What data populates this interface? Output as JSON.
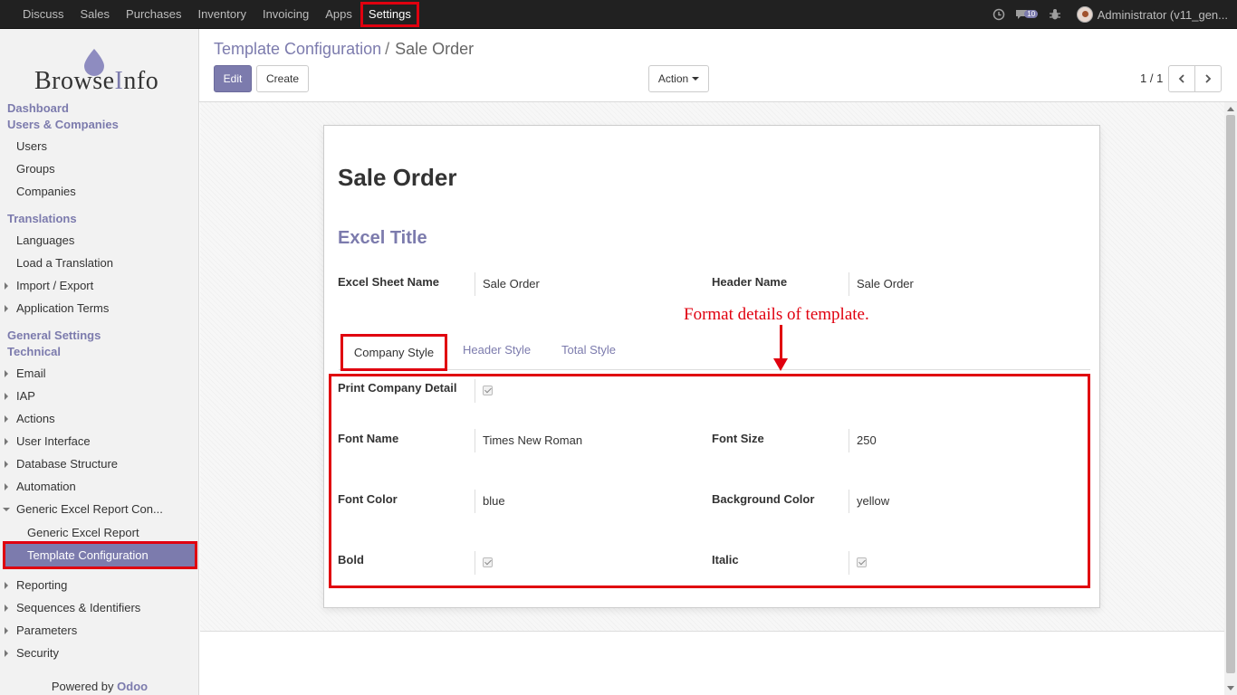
{
  "topbar": {
    "menu": [
      "Discuss",
      "Sales",
      "Purchases",
      "Inventory",
      "Invoicing",
      "Apps",
      "Settings"
    ],
    "active": "Settings",
    "messages_count": "10",
    "user": "Administrator (v11_gen..."
  },
  "logo": {
    "text_before": "Browse",
    "text_accent": "I",
    "text_after": "nfo"
  },
  "sidebar": {
    "dashboard": "Dashboard",
    "users_companies": "Users & Companies",
    "users": "Users",
    "groups": "Groups",
    "companies": "Companies",
    "translations": "Translations",
    "languages": "Languages",
    "load_translation": "Load a Translation",
    "import_export": "Import / Export",
    "application_terms": "Application Terms",
    "general_settings": "General Settings",
    "technical": "Technical",
    "email": "Email",
    "iap": "IAP",
    "actions": "Actions",
    "user_interface": "User Interface",
    "database_structure": "Database Structure",
    "automation": "Automation",
    "generic_excel_config": "Generic Excel Report Con...",
    "generic_excel_report": "Generic Excel Report",
    "template_configuration": "Template Configuration",
    "reporting": "Reporting",
    "sequences": "Sequences & Identifiers",
    "parameters": "Parameters",
    "security": "Security",
    "powered_by": "Powered by ",
    "odoo": "Odoo"
  },
  "breadcrumb": {
    "parent": "Template Configuration",
    "separator": "/",
    "current": "Sale Order"
  },
  "buttons": {
    "edit": "Edit",
    "create": "Create",
    "action": "Action"
  },
  "pager": "1 / 1",
  "record": {
    "title": "Sale Order",
    "section": "Excel Title",
    "excel_sheet_name_label": "Excel Sheet Name",
    "excel_sheet_name": "Sale Order",
    "header_name_label": "Header Name",
    "header_name": "Sale Order"
  },
  "tabs": [
    "Company Style",
    "Header Style",
    "Total Style"
  ],
  "company_style": {
    "print_company_detail_label": "Print Company Detail",
    "print_company_detail": true,
    "font_name_label": "Font Name",
    "font_name": "Times New Roman",
    "font_size_label": "Font Size",
    "font_size": "250",
    "font_color_label": "Font Color",
    "font_color": "blue",
    "background_color_label": "Background Color",
    "background_color": "yellow",
    "bold_label": "Bold",
    "bold": true,
    "italic_label": "Italic",
    "italic": true
  },
  "annotation": "Format details of template.",
  "colors": {
    "accent": "#7c7bad",
    "highlight": "#e0000f",
    "topbar": "#212121"
  }
}
